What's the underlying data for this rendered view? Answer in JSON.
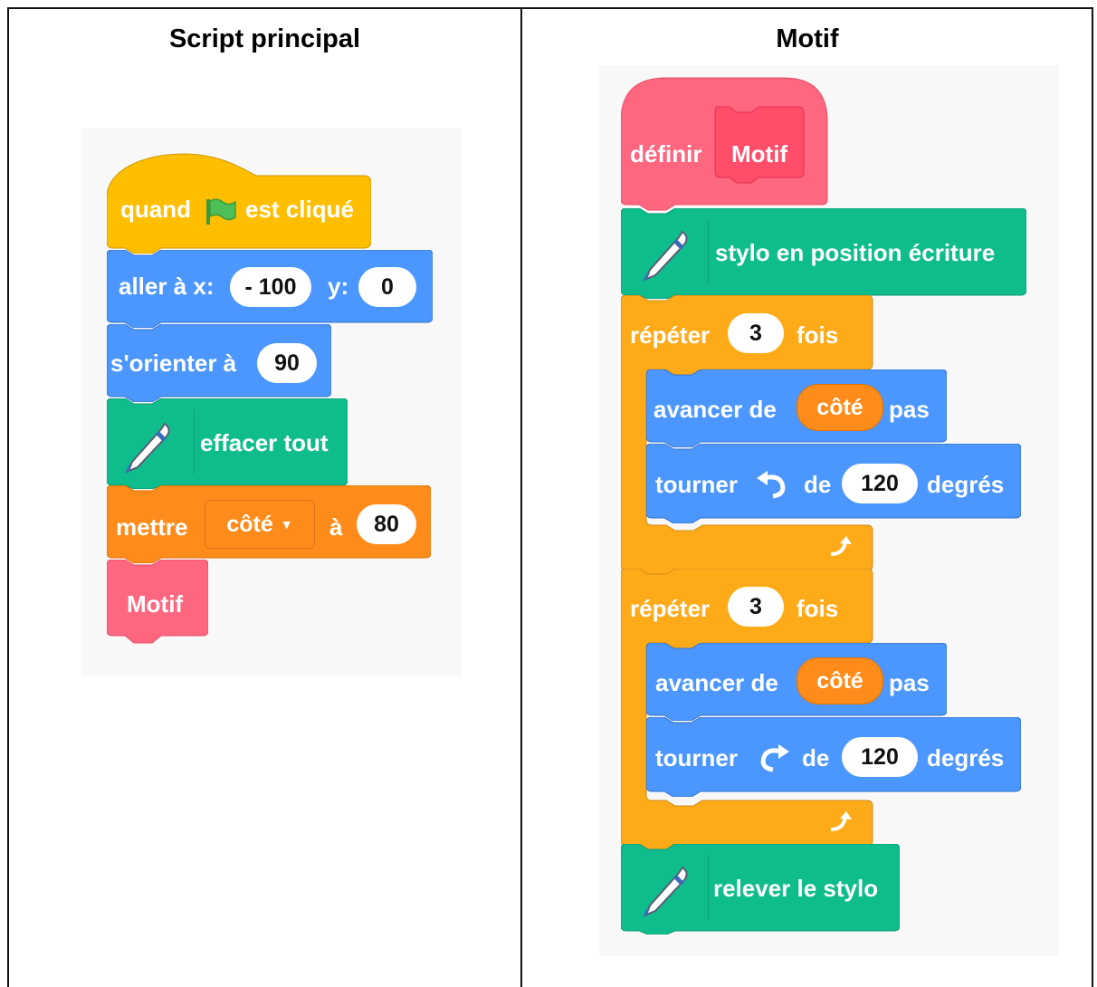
{
  "left": {
    "title": "Script principal",
    "hat": {
      "when": "quand",
      "clicked": "est cliqué"
    },
    "goto": {
      "label": "aller à x:",
      "x": "- 100",
      "ylabel": "y:",
      "y": "0"
    },
    "orient": {
      "label": "s'orienter à",
      "value": "90"
    },
    "clear": {
      "label": "effacer tout"
    },
    "setvar": {
      "label": "mettre",
      "var": "côté",
      "to": "à",
      "value": "80"
    },
    "call": {
      "label": "Motif"
    }
  },
  "right": {
    "title": "Motif",
    "define": {
      "label": "définir",
      "name": "Motif"
    },
    "pendown": {
      "label": "stylo en position écriture"
    },
    "repeat1": {
      "label": "répéter",
      "count": "3",
      "times": "fois"
    },
    "move1": {
      "label": "avancer de",
      "var": "côté",
      "unit": "pas"
    },
    "turn1": {
      "label": "tourner",
      "of": "de",
      "value": "120",
      "unit": "degrés"
    },
    "repeat2": {
      "label": "répéter",
      "count": "3",
      "times": "fois"
    },
    "move2": {
      "label": "avancer de",
      "var": "côté",
      "unit": "pas"
    },
    "turn2": {
      "label": "tourner",
      "of": "de",
      "value": "120",
      "unit": "degrés"
    },
    "penup": {
      "label": "relever le stylo"
    }
  },
  "colors": {
    "events": "#ffbf00",
    "motion": "#4c97ff",
    "pen": "#0fbd8c",
    "variables": "#ff8c1a",
    "control": "#ffab19",
    "myblocks": "#ff6680"
  }
}
